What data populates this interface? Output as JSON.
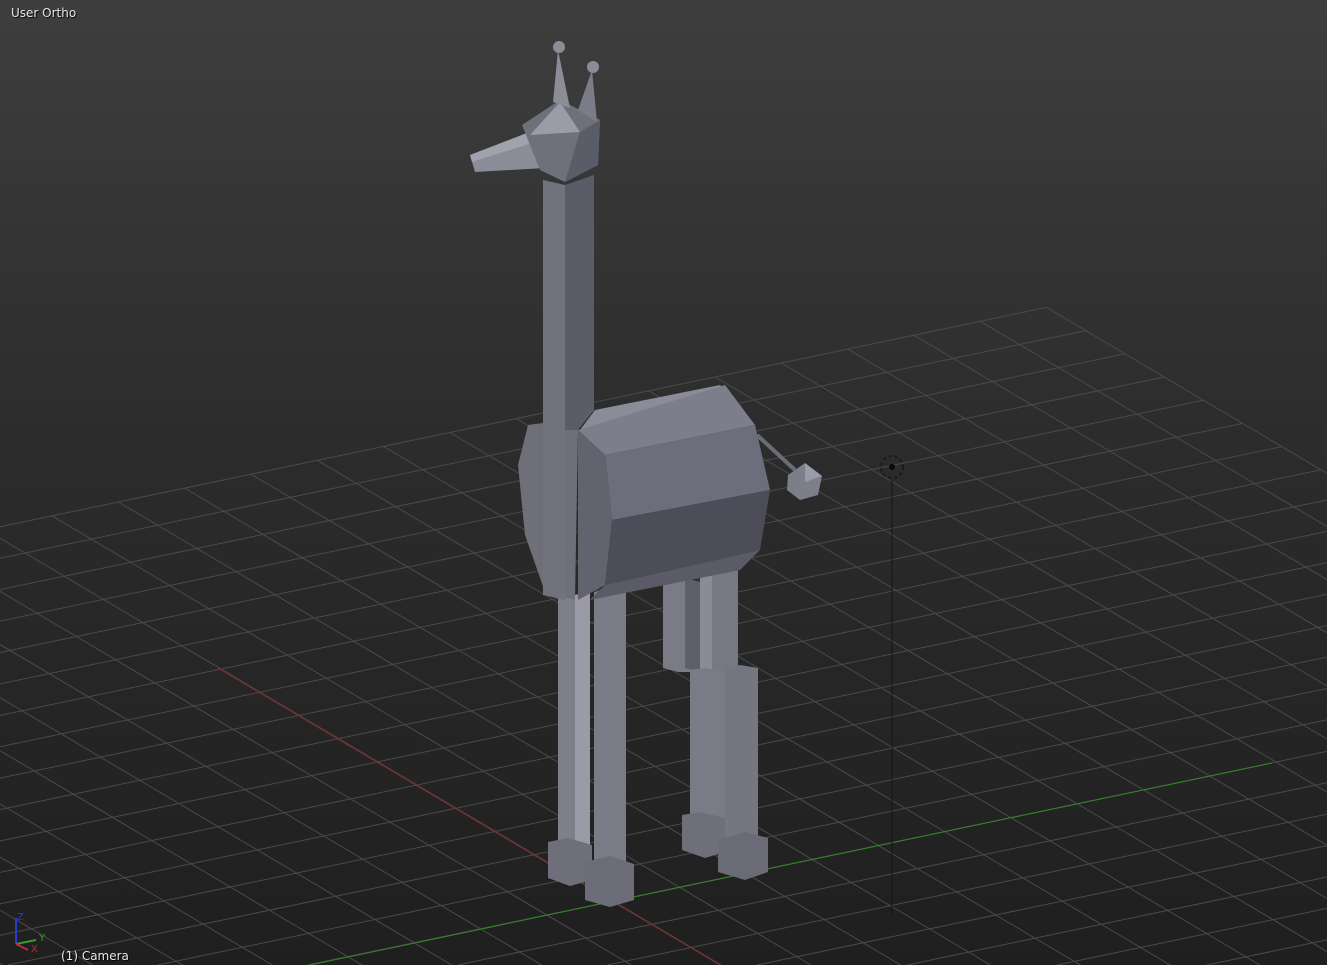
{
  "viewport": {
    "view_name": "User Ortho",
    "object_info": "(1) Camera",
    "axes": {
      "x": "X",
      "y": "Y",
      "z": "Z"
    },
    "colors": {
      "x_axis": "#b03030",
      "y_axis": "#3a9a2a",
      "z_axis": "#2a3ad0",
      "grid": "#4a4a4a",
      "mesh": "#6e707c"
    },
    "icons": [
      "3d-cursor-icon",
      "axis-gizmo-icon"
    ]
  }
}
